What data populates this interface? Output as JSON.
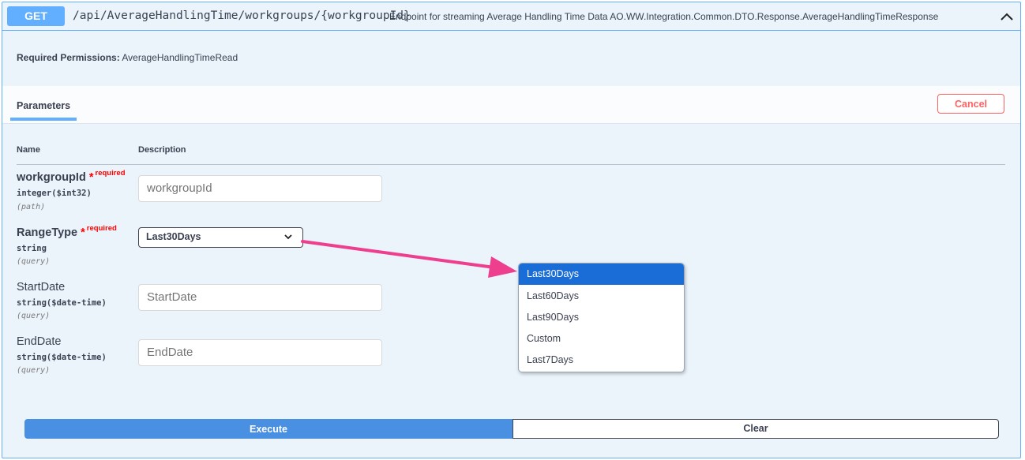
{
  "endpoint": {
    "method": "GET",
    "path": "/api/AverageHandlingTime/workgroups/{workgroupId}",
    "summary": "Endpoint for streaming Average Handling Time Data AO.WW.Integration.Common.DTO.Response.AverageHandlingTimeResponse"
  },
  "permissions": {
    "label": "Required Permissions:",
    "value": "AverageHandlingTimeRead"
  },
  "parameters_tab": {
    "label": "Parameters",
    "cancel_label": "Cancel",
    "col_name": "Name",
    "col_description": "Description"
  },
  "params": [
    {
      "name": "workgroupId",
      "required_star": "*",
      "required_label": "required",
      "type": "integer($int32)",
      "in": "(path)",
      "placeholder": "workgroupId"
    },
    {
      "name": "RangeType",
      "required_star": "*",
      "required_label": "required",
      "type": "string",
      "in": "(query)",
      "selected": "Last30Days"
    },
    {
      "name": "StartDate",
      "type": "string($date-time)",
      "in": "(query)",
      "placeholder": "StartDate"
    },
    {
      "name": "EndDate",
      "type": "string($date-time)",
      "in": "(query)",
      "placeholder": "EndDate"
    }
  ],
  "dropdown": {
    "options": [
      "Last30Days",
      "Last60Days",
      "Last90Days",
      "Custom",
      "Last7Days"
    ]
  },
  "colors": {
    "accent": "#61affe",
    "execute": "#4a90e2",
    "cancel": "#ff6060",
    "required": "#ff0000",
    "annotation_arrow": "#ee3f8e",
    "selected_option": "#1a6dd6"
  },
  "actions": {
    "execute_label": "Execute",
    "clear_label": "Clear"
  }
}
